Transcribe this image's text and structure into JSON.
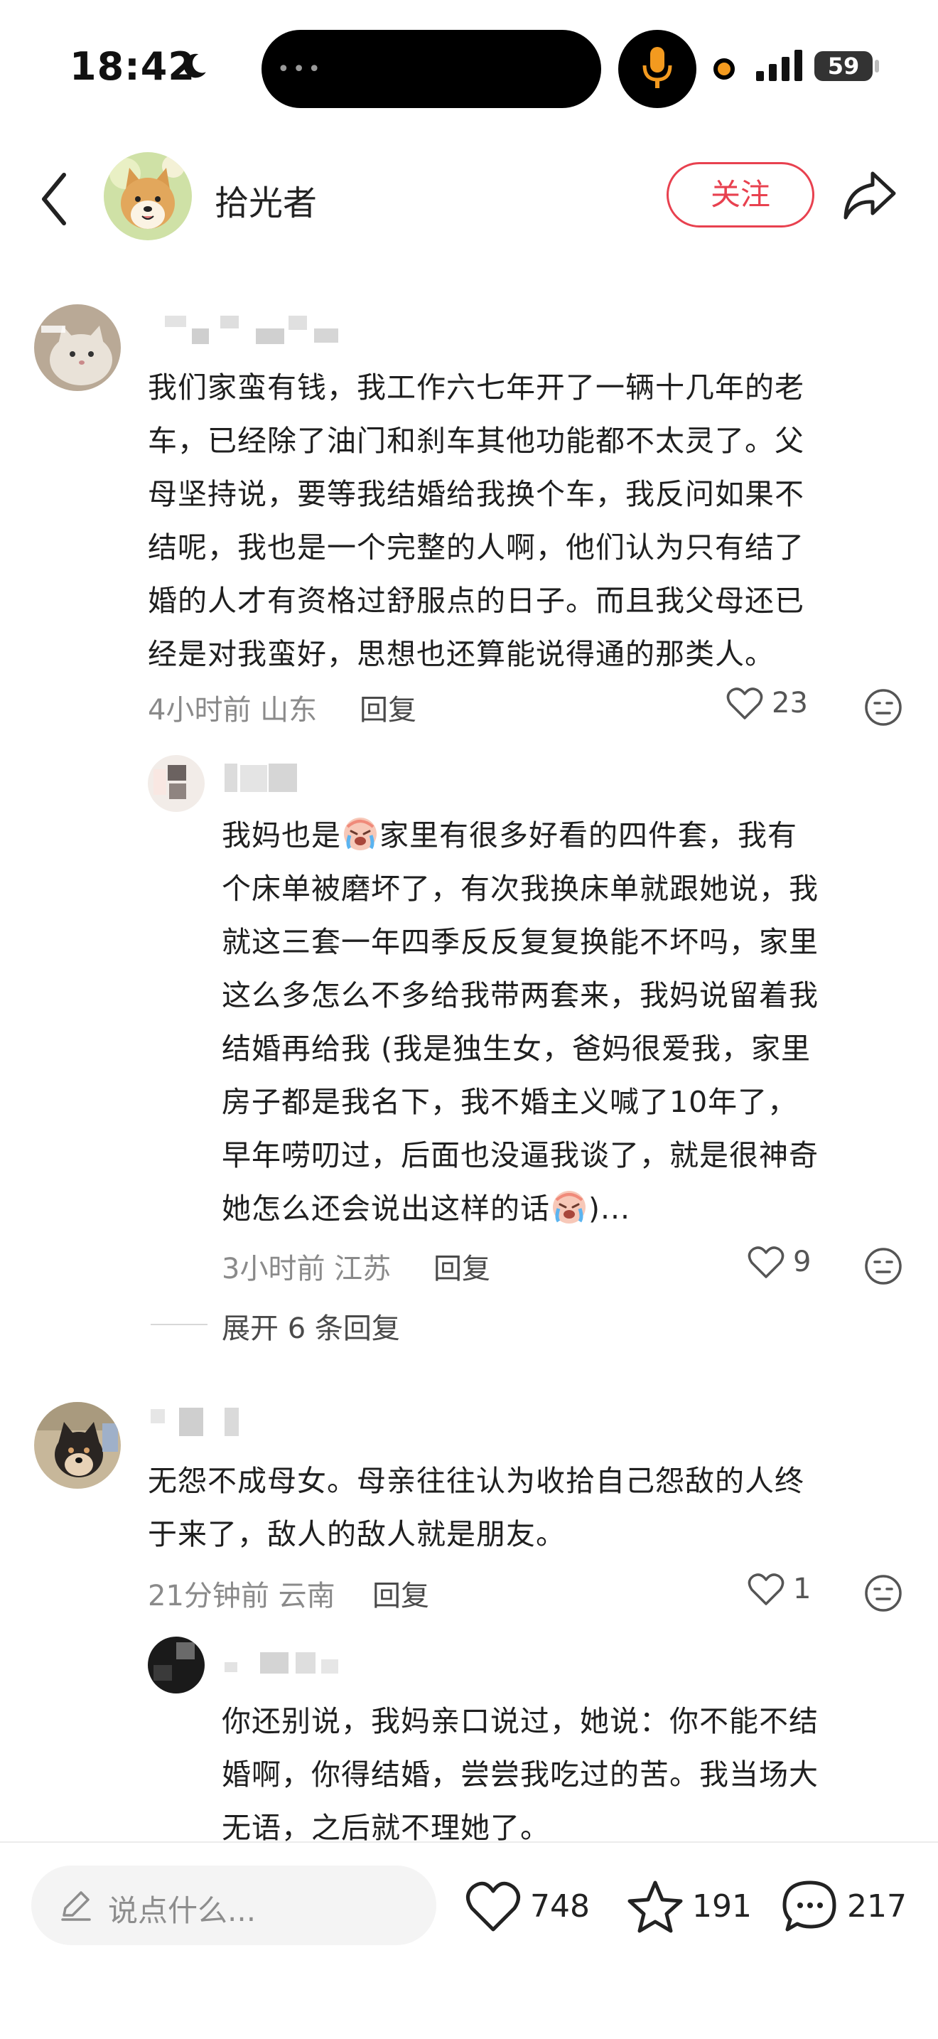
{
  "status_bar": {
    "time": "18:42",
    "battery": "59"
  },
  "header": {
    "author_name": "拾光者",
    "follow_label": "关注"
  },
  "comments": [
    {
      "lines": [
        "我们家蛮有钱，我工作六七年开了一辆十几年的老",
        "车，已经除了油门和刹车其他功能都不太灵了。父",
        "母坚持说，要等我结婚给我换个车，我反问如果不",
        "结呢，我也是一个完整的人啊，他们认为只有结了",
        "婚的人才有资格过舒服点的日子。而且我父母还已",
        "经是对我蛮好，思想也还算能说得通的那类人。"
      ],
      "meta": "4小时前 山东",
      "reply_label": "回复",
      "likes": "23"
    },
    {
      "lines_1_a": "我妈也是",
      "lines_1_b": "家里有很多好看的四件套，我有",
      "lines": [
        "个床单被磨坏了，有次我换床单就跟她说，我",
        "就这三套一年四季反反复复换能不坏吗，家里",
        "这么多怎么不多给我带两套来，我妈说留着我",
        "结婚再给我 (我是独生女，爸妈很爱我，家里",
        "房子都是我名下，我不婚主义喊了10年了，",
        "早年唠叨过，后面也没逼我谈了，就是很神奇"
      ],
      "last_line_a": "她怎么还会说出这样的话",
      "last_line_b": ")...",
      "meta": "3小时前 江苏",
      "reply_label": "回复",
      "likes": "9",
      "expand_label": "展开 6 条回复"
    },
    {
      "lines": [
        "无怨不成母女。母亲往往认为收拾自己怨敌的人终",
        "于来了，敌人的敌人就是朋友。"
      ],
      "meta": "21分钟前 云南",
      "reply_label": "回复",
      "likes": "1"
    },
    {
      "lines": [
        "你还别说，我妈亲口说过，她说：你不能不结",
        "婚啊，你得结婚，尝尝我吃过的苦。我当场大",
        "无语，之后就不理她了。"
      ]
    }
  ],
  "bottom_bar": {
    "placeholder": "说点什么...",
    "likes": "748",
    "favorites": "191",
    "comments": "217"
  },
  "icons": {
    "back": "chevron-left-icon",
    "share": "share-arrow-icon",
    "heart": "heart-icon",
    "star": "star-icon",
    "chat": "chat-bubble-icon",
    "face": "neutral-face-icon"
  },
  "colors": {
    "accent": "#e8414f",
    "meta_text": "#8a8a8a"
  }
}
